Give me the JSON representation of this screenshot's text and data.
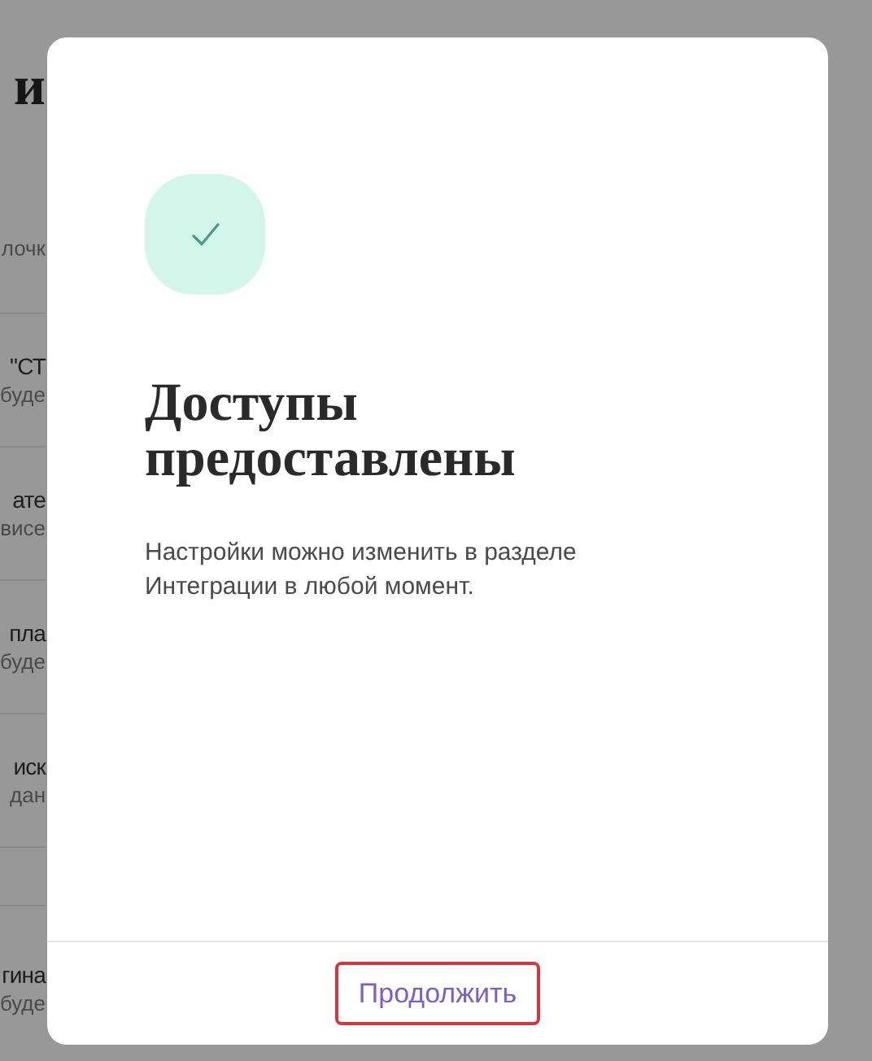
{
  "background": {
    "heading": "и",
    "rows": [
      {
        "subtitle": "лочк"
      },
      {
        "title": "\"СТ",
        "subtitle": "буде"
      },
      {
        "title": "ате",
        "subtitle": "висе"
      },
      {
        "title": "пла",
        "subtitle": "буде"
      },
      {
        "title": "иск",
        "subtitle": "дан"
      },
      {
        "title": "гина",
        "subtitle": "буде"
      }
    ]
  },
  "dialog": {
    "title": "Доступы предоставлены",
    "message": "Настройки можно изменить в разделе Интеграции в любой момент.",
    "button": "Продолжить"
  }
}
